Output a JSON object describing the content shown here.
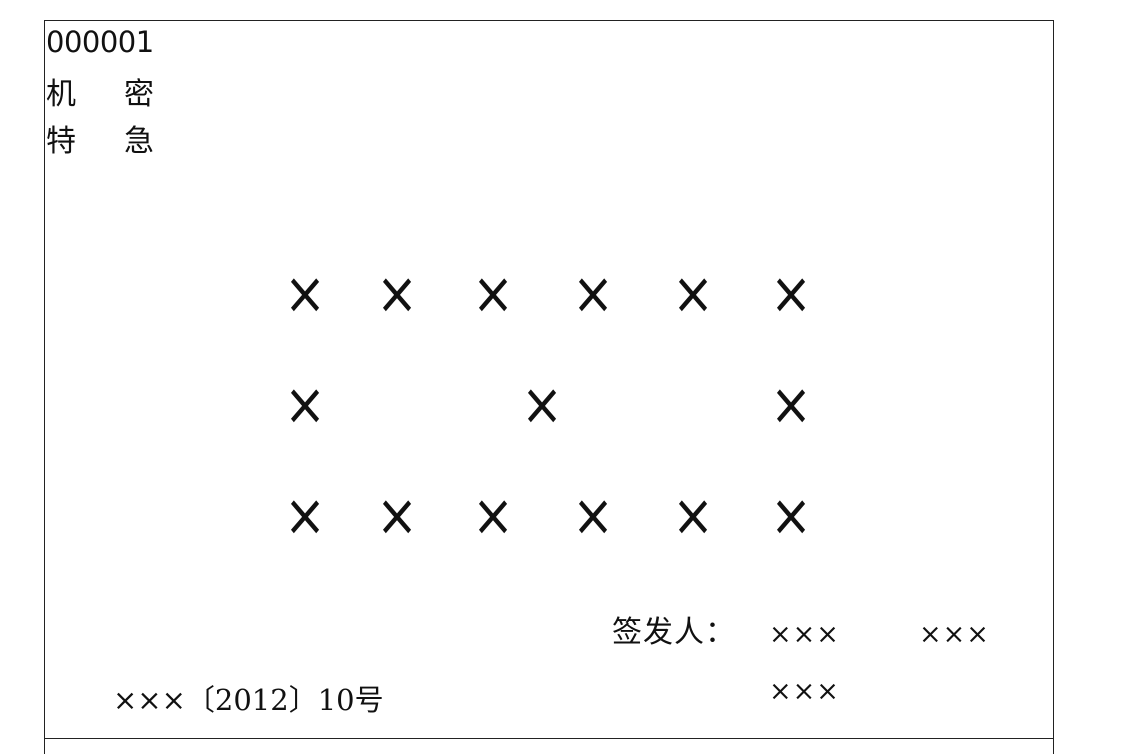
{
  "document": {
    "copy_number": "000001",
    "classification": {
      "char1": "机",
      "char2": "密"
    },
    "urgency": {
      "char1": "特",
      "char2": "急"
    },
    "issuer_title": {
      "rows": [
        [
          "×",
          "×",
          "×",
          "×",
          "×",
          "×"
        ],
        [
          "×",
          "×",
          "×"
        ],
        [
          "×",
          "×",
          "×",
          "×",
          "×",
          "×"
        ]
      ]
    },
    "signers": {
      "label": "签发人：",
      "names": [
        "×××",
        "×××",
        "×××"
      ]
    },
    "document_number": "×××〔2012〕10号"
  }
}
